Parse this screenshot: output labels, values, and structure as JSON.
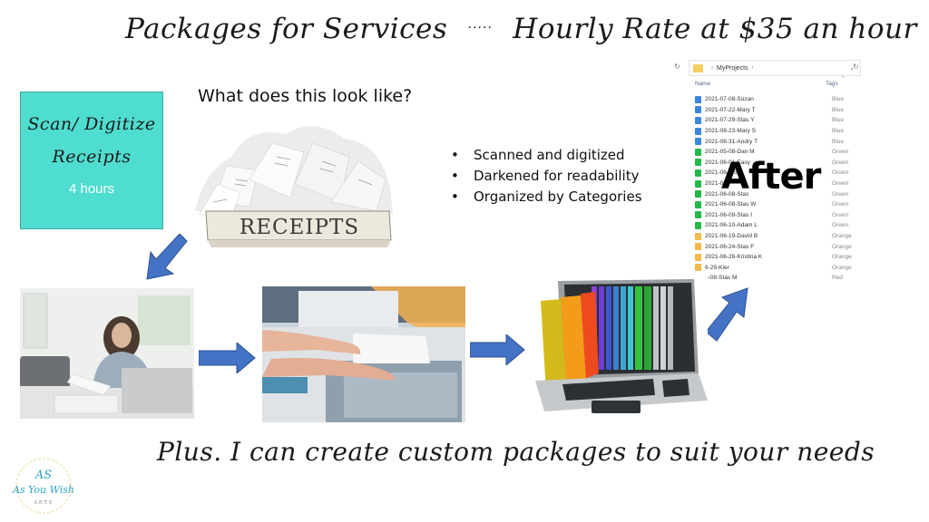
{
  "title": {
    "left": "Packages for Services",
    "separator": ".....",
    "right": "Hourly Rate at $35 an hour"
  },
  "service_box": {
    "line1": "Scan/ Digitize",
    "line2": "Receipts",
    "hours": "4 hours",
    "color": "#4fddd0"
  },
  "question": "What does this look like?",
  "receipts_label": "RECEIPTS",
  "bullets": [
    "Scanned and digitized",
    "Darkened for readability",
    "Organized by Categories"
  ],
  "after_label": "After",
  "explorer": {
    "breadcrumb": "MyProjects",
    "columns": {
      "name": "Name",
      "tags": "Tags"
    },
    "files": [
      {
        "name": "2021-07-08-Suzan",
        "tag": "Blue",
        "color": "#3a86e0"
      },
      {
        "name": "2021-07-22-Mary T",
        "tag": "Blue",
        "color": "#3a86e0"
      },
      {
        "name": "2021-07-29-Stas Y",
        "tag": "Blue",
        "color": "#3a86e0"
      },
      {
        "name": "2021-08-23-Mary S",
        "tag": "Blue",
        "color": "#3a86e0"
      },
      {
        "name": "2021-08-31-Andry T",
        "tag": "Blue",
        "color": "#3a86e0"
      },
      {
        "name": "2021-05-08-Dan M",
        "tag": "Green",
        "color": "#22b84a"
      },
      {
        "name": "2021-06-01-Easy",
        "tag": "Green",
        "color": "#22b84a"
      },
      {
        "name": "2021-06-0 S",
        "tag": "Green",
        "color": "#22b84a"
      },
      {
        "name": "2021-0 e",
        "tag": "Green",
        "color": "#22b84a"
      },
      {
        "name": "2021-06-08-Stas",
        "tag": "Green",
        "color": "#22b84a"
      },
      {
        "name": "2021-06-08-Stas W",
        "tag": "Green",
        "color": "#22b84a"
      },
      {
        "name": "2021-06-09-Stas I",
        "tag": "Green",
        "color": "#22b84a"
      },
      {
        "name": "2021-06-10-Adam L",
        "tag": "Green",
        "color": "#22b84a"
      },
      {
        "name": "2021-06-19-David B",
        "tag": "Orange",
        "color": "#f3b94a"
      },
      {
        "name": "2021-06-24-Stas F",
        "tag": "Orange",
        "color": "#f3b94a"
      },
      {
        "name": "2021-06-26-Kristina K",
        "tag": "Orange",
        "color": "#f3b94a"
      },
      {
        "name": "6-29-Kler",
        "tag": "Orange",
        "color": "#f3b94a"
      },
      {
        "name": "6-08-Stas M",
        "tag": "Red",
        "color": "#ffffff"
      }
    ]
  },
  "images": {
    "receipts_box": "box-of-receipts",
    "woman": "woman-reviewing-papers-at-laptop",
    "scanner": "hands-on-copier-scanner",
    "laptop": "laptop-with-colored-folders"
  },
  "footer": "Plus. I can create custom packages to suit your needs",
  "logo": {
    "monogram": "AS",
    "name": "As You Wish",
    "sub": "ARTS"
  },
  "arrow_color": "#4472c4"
}
